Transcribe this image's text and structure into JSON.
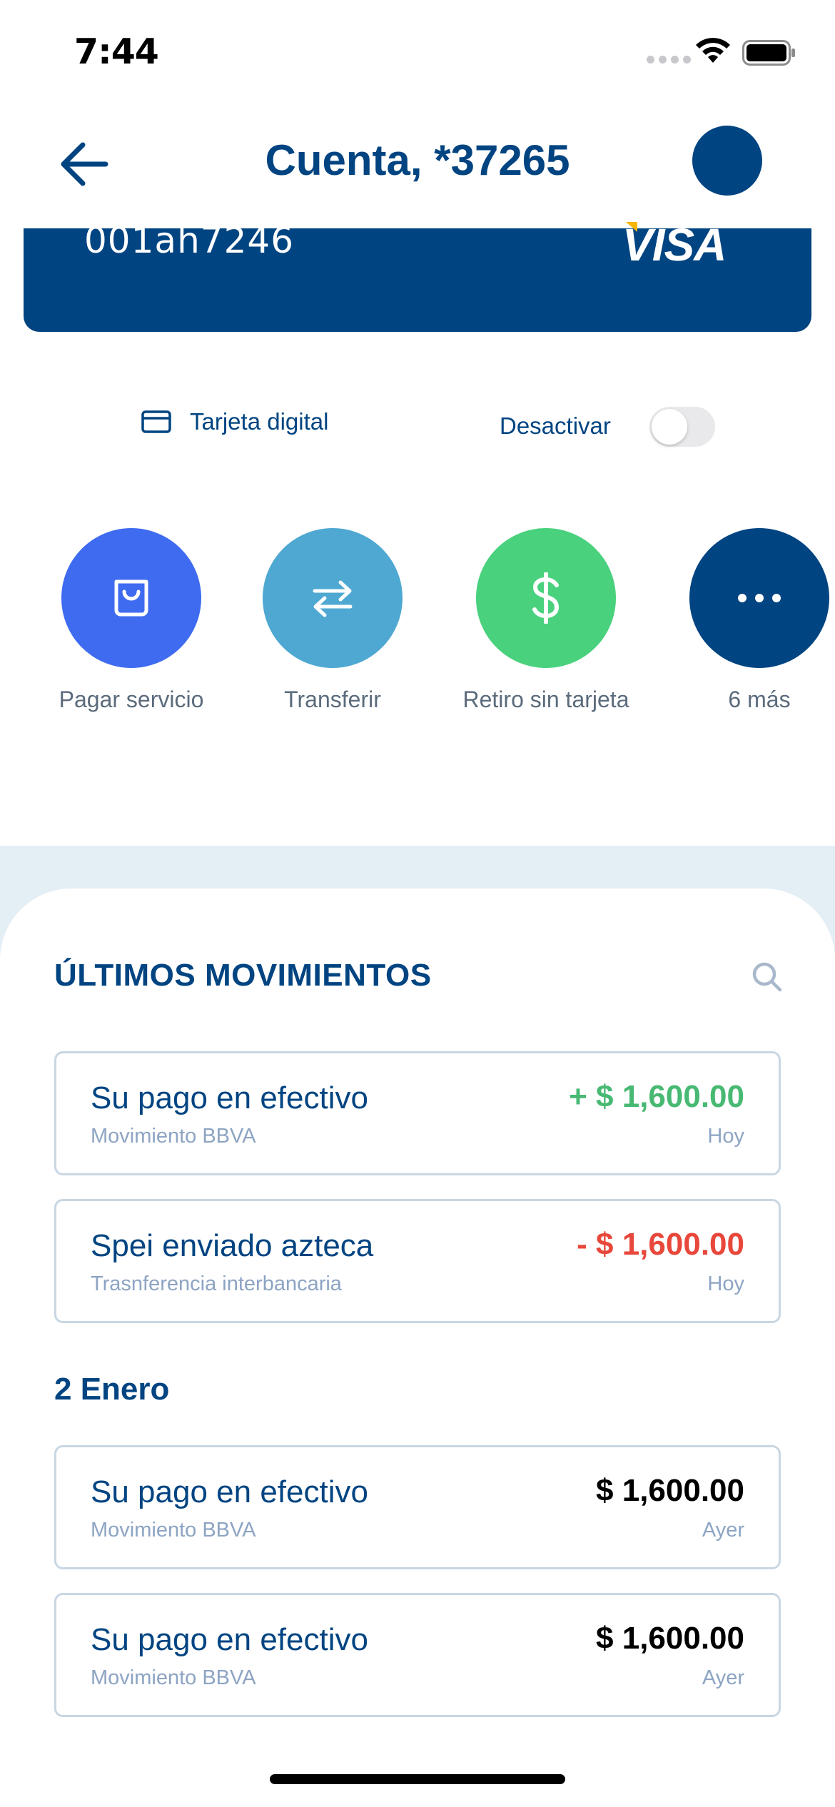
{
  "status_bar": {
    "time": "7:44"
  },
  "header": {
    "title": "Cuenta, *37265",
    "back_icon": "arrow-left-icon"
  },
  "card": {
    "number": "001ah7246",
    "brand": "VISA"
  },
  "card_options": {
    "digital_card_label": "Tarjeta digital",
    "deactivate_label": "Desactivar",
    "deactivate_toggle_on": false
  },
  "actions": [
    {
      "label": "Pagar servicio",
      "icon": "shopping-bag-icon",
      "color": "#3e6bf0"
    },
    {
      "label": "Transferir",
      "icon": "transfer-arrows-icon",
      "color": "#4ea8d2"
    },
    {
      "label": "Retiro sin tarjeta",
      "icon": "dollar-icon",
      "color": "#49d17d"
    },
    {
      "label": "6 más",
      "icon": "more-dots-icon",
      "color": "#004481"
    }
  ],
  "movements": {
    "section_title": "ÚLTIMOS MOVIMIENTOS",
    "recent": [
      {
        "title": "Su pago en efectivo",
        "subtitle": "Movimiento BBVA",
        "amount": "+ $ 1,600.00",
        "date": "Hoy",
        "type": "credit"
      },
      {
        "title": "Spei enviado azteca",
        "subtitle": "Trasnferencia interbancaria",
        "amount": "- $ 1,600.00",
        "date": "Hoy",
        "type": "debit"
      }
    ],
    "group_date": "2 Enero",
    "earlier": [
      {
        "title": "Su pago en efectivo",
        "subtitle": "Movimiento BBVA",
        "amount": "$ 1,600.00",
        "date": "Ayer",
        "type": "neutral"
      },
      {
        "title": "Su pago en efectivo",
        "subtitle": "Movimiento BBVA",
        "amount": "$ 1,600.00",
        "date": "Ayer",
        "type": "neutral"
      }
    ]
  },
  "colors": {
    "brand": "#004481",
    "credit": "#48b973",
    "debit": "#e8483b",
    "neutral": "#000000"
  }
}
